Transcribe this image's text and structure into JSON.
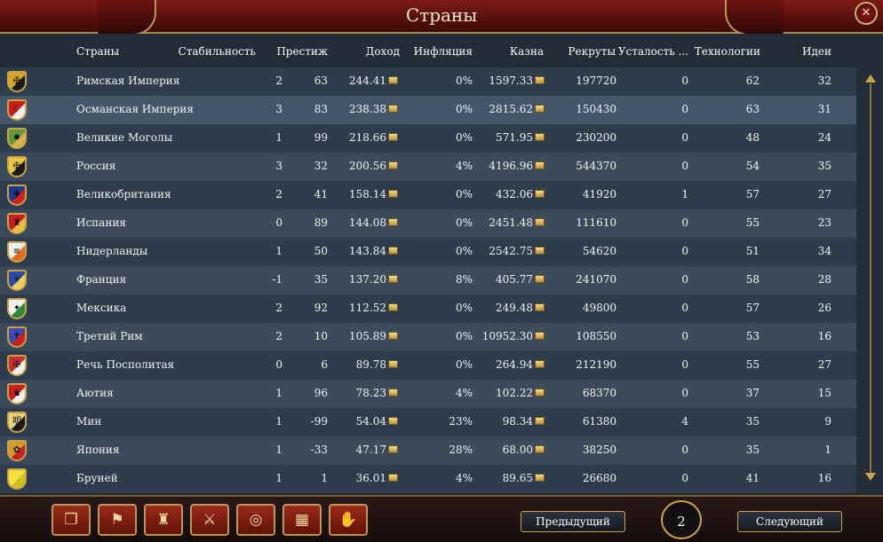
{
  "window": {
    "title": "Страны",
    "close_label": "✕"
  },
  "columns": [
    "Страны",
    "Стабильность",
    "Престиж",
    "Доход",
    "Инфляция",
    "Казна",
    "Рекруты",
    "Усталость ...",
    "Технологии",
    "Идеи"
  ],
  "rows": [
    {
      "name": "Римская Империя",
      "stability": "2",
      "prestige": "63",
      "income": "244.41",
      "inflation": "0%",
      "treasury": "1597.33",
      "manpower": "197720",
      "war_exhaustion": "0",
      "tech": "62",
      "ideas": "32",
      "flag_colors": [
        "#d4a62a",
        "#1a1a1a"
      ],
      "flag_icon": "eagle-icon",
      "flag_glyph": "✠"
    },
    {
      "name": "Османская Империя",
      "stability": "3",
      "prestige": "83",
      "income": "238.38",
      "inflation": "0%",
      "treasury": "2815.62",
      "manpower": "150430",
      "war_exhaustion": "0",
      "tech": "63",
      "ideas": "31",
      "flag_colors": [
        "#c81e1e",
        "#f0f0f0"
      ],
      "flag_icon": "crescent-icon",
      "flag_glyph": "☾"
    },
    {
      "name": "Великие Моголы",
      "stability": "1",
      "prestige": "99",
      "income": "218.66",
      "inflation": "0%",
      "treasury": "571.95",
      "manpower": "230200",
      "war_exhaustion": "0",
      "tech": "48",
      "ideas": "24",
      "flag_colors": [
        "#5f9a3a",
        "#d4b24a"
      ],
      "flag_icon": "sun-icon",
      "flag_glyph": "✹"
    },
    {
      "name": "Россия",
      "stability": "3",
      "prestige": "32",
      "income": "200.56",
      "inflation": "4%",
      "treasury": "4196.96",
      "manpower": "544370",
      "war_exhaustion": "0",
      "tech": "54",
      "ideas": "35",
      "flag_colors": [
        "#e8c640",
        "#1a1a1a"
      ],
      "flag_icon": "double-eagle-icon",
      "flag_glyph": "✠"
    },
    {
      "name": "Великобритания",
      "stability": "2",
      "prestige": "41",
      "income": "158.14",
      "inflation": "0%",
      "treasury": "432.06",
      "manpower": "41920",
      "war_exhaustion": "1",
      "tech": "57",
      "ideas": "27",
      "flag_colors": [
        "#1e3a8a",
        "#cc2222"
      ],
      "flag_icon": "union-jack-icon",
      "flag_glyph": "✚"
    },
    {
      "name": "Испания",
      "stability": "0",
      "prestige": "89",
      "income": "144.08",
      "inflation": "0%",
      "treasury": "2451.48",
      "manpower": "111610",
      "war_exhaustion": "0",
      "tech": "55",
      "ideas": "23",
      "flag_colors": [
        "#c82020",
        "#e8c040"
      ],
      "flag_icon": "castle-icon",
      "flag_glyph": "♜"
    },
    {
      "name": "Нидерланды",
      "stability": "1",
      "prestige": "50",
      "income": "143.84",
      "inflation": "0%",
      "treasury": "2542.75",
      "manpower": "54620",
      "war_exhaustion": "0",
      "tech": "51",
      "ideas": "34",
      "flag_colors": [
        "#f0f0f0",
        "#e86a20"
      ],
      "flag_icon": "tricolor-icon",
      "flag_glyph": "≡"
    },
    {
      "name": "Франция",
      "stability": "-1",
      "prestige": "35",
      "income": "137.20",
      "inflation": "8%",
      "treasury": "405.77",
      "manpower": "241070",
      "war_exhaustion": "0",
      "tech": "58",
      "ideas": "28",
      "flag_colors": [
        "#2a4aa8",
        "#e8d060"
      ],
      "flag_icon": "fleur-de-lis-icon",
      "flag_glyph": "⚜"
    },
    {
      "name": "Мексика",
      "stability": "2",
      "prestige": "92",
      "income": "112.52",
      "inflation": "0%",
      "treasury": "249.48",
      "manpower": "49800",
      "war_exhaustion": "0",
      "tech": "57",
      "ideas": "26",
      "flag_colors": [
        "#f0f0f0",
        "#2a8a3a"
      ],
      "flag_icon": "eagle-icon",
      "flag_glyph": "✦"
    },
    {
      "name": "Третий Рим",
      "stability": "2",
      "prestige": "10",
      "income": "105.89",
      "inflation": "0%",
      "treasury": "10952.30",
      "manpower": "108550",
      "war_exhaustion": "0",
      "tech": "53",
      "ideas": "16",
      "flag_colors": [
        "#3a4ab0",
        "#c82020"
      ],
      "flag_icon": "cross-icon",
      "flag_glyph": "✝"
    },
    {
      "name": "Речь Посполитая",
      "stability": "0",
      "prestige": "6",
      "income": "89.78",
      "inflation": "0%",
      "treasury": "264.94",
      "manpower": "212190",
      "war_exhaustion": "0",
      "tech": "55",
      "ideas": "27",
      "flag_colors": [
        "#c83030",
        "#f0f0f0"
      ],
      "flag_icon": "eagle-icon",
      "flag_glyph": "✠"
    },
    {
      "name": "Аютия",
      "stability": "1",
      "prestige": "96",
      "income": "78.23",
      "inflation": "4%",
      "treasury": "102.22",
      "manpower": "68370",
      "war_exhaustion": "0",
      "tech": "37",
      "ideas": "15",
      "flag_colors": [
        "#c82020",
        "#f0f0f0"
      ],
      "flag_icon": "elephant-icon",
      "flag_glyph": "♞"
    },
    {
      "name": "Мин",
      "stability": "1",
      "prestige": "-99",
      "income": "54.04",
      "inflation": "23%",
      "treasury": "98.34",
      "manpower": "61380",
      "war_exhaustion": "4",
      "tech": "35",
      "ideas": "9",
      "flag_colors": [
        "#e8d080",
        "#1a1a1a"
      ],
      "flag_icon": "ming-glyph-icon",
      "flag_glyph": "明"
    },
    {
      "name": "Япония",
      "stability": "1",
      "prestige": "-33",
      "income": "47.17",
      "inflation": "28%",
      "treasury": "68.00",
      "manpower": "38250",
      "war_exhaustion": "0",
      "tech": "35",
      "ideas": "1",
      "flag_colors": [
        "#d49a2a",
        "#c82020"
      ],
      "flag_icon": "chrysanthemum-icon",
      "flag_glyph": "✿"
    },
    {
      "name": "Бруней",
      "stability": "1",
      "prestige": "1",
      "income": "36.01",
      "inflation": "4%",
      "treasury": "89.65",
      "manpower": "26680",
      "war_exhaustion": "0",
      "tech": "41",
      "ideas": "16",
      "flag_colors": [
        "#f0e040",
        "#d0c020"
      ],
      "flag_icon": "plain-yellow-icon",
      "flag_glyph": ""
    }
  ],
  "footer": {
    "buttons": [
      {
        "name": "ledger-button",
        "icon": "book-icon",
        "glyph": "❐"
      },
      {
        "name": "flag-button",
        "icon": "flag-icon",
        "glyph": "⚑"
      },
      {
        "name": "buildings-button",
        "icon": "buildings-icon",
        "glyph": "♜"
      },
      {
        "name": "military-button",
        "icon": "crossed-swords-icon",
        "glyph": "⚔"
      },
      {
        "name": "economy-button",
        "icon": "coins-icon",
        "glyph": "◎"
      },
      {
        "name": "trade-button",
        "icon": "crate-icon",
        "glyph": "▦"
      },
      {
        "name": "diplomacy-button",
        "icon": "handshake-icon",
        "glyph": "✋"
      }
    ],
    "prev_label": "Предыдущий",
    "next_label": "Следующий",
    "page": "2"
  },
  "colors": {
    "header": "#6e1610",
    "gold": "#c9a24a",
    "row_odd": "#2e3d4b",
    "row_even": "#3b4b5a"
  }
}
